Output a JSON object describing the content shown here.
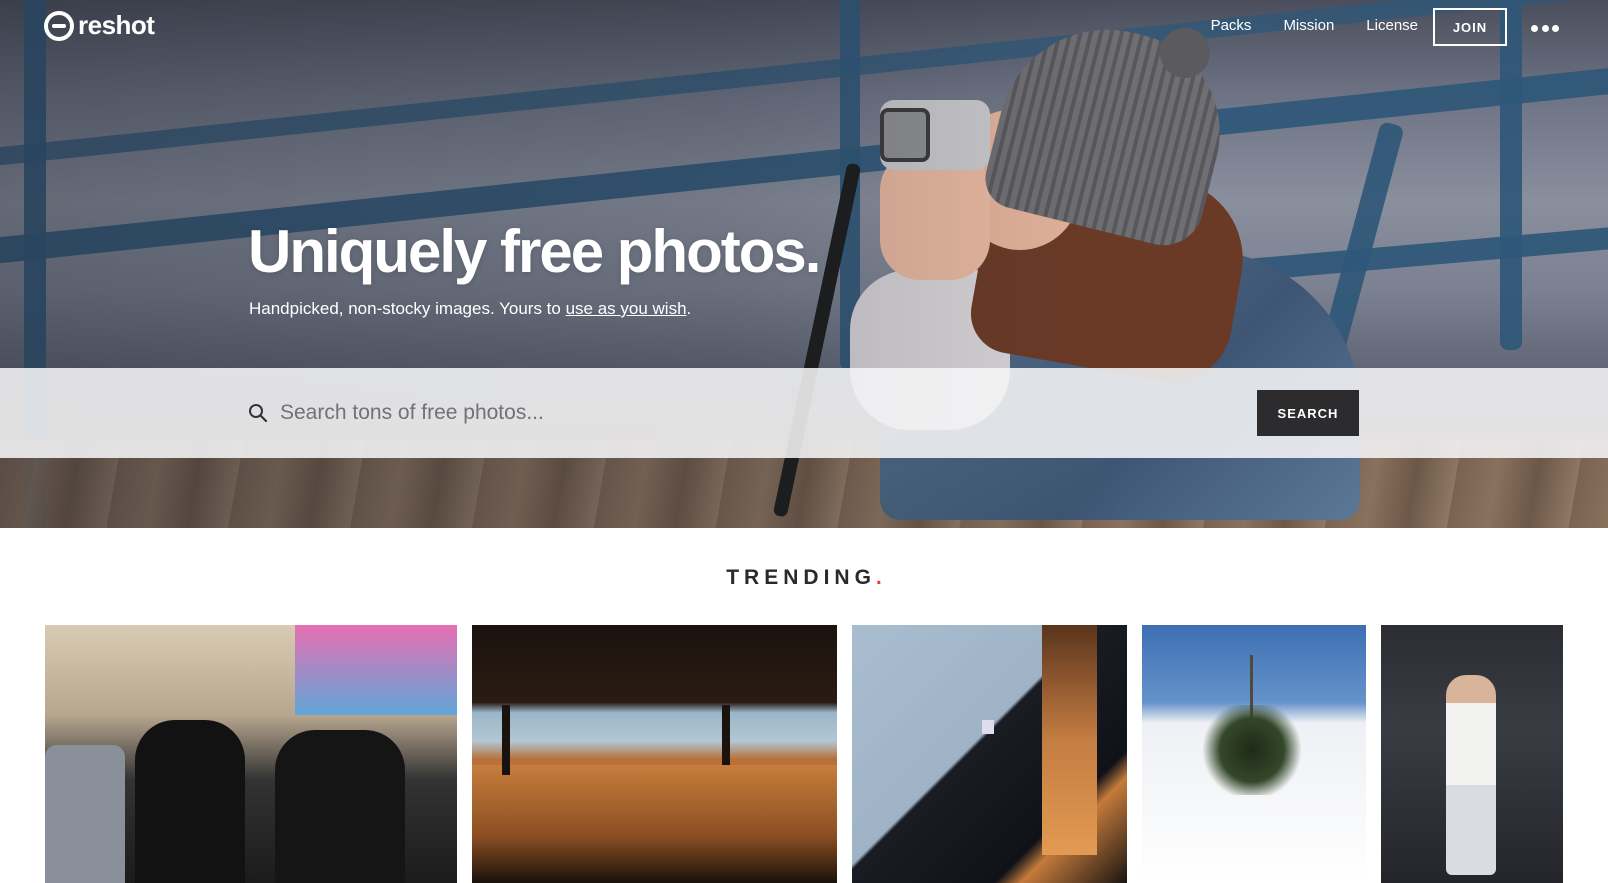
{
  "nav": {
    "logo_text": "reshot",
    "links": [
      "Packs",
      "Mission",
      "License"
    ],
    "join_label": "JOIN"
  },
  "hero": {
    "headline": "Uniquely free photos.",
    "subline_text": "Handpicked, non-stocky images. Yours to ",
    "subline_link": "use as you wish",
    "subline_end": "."
  },
  "search": {
    "placeholder": "Search tons of free photos...",
    "button_label": "SEARCH"
  },
  "trending": {
    "title": "TRENDING",
    "dot": ".",
    "accent_color": "#e0433a"
  },
  "icons": {
    "logo": "reshot-logo-icon",
    "more": "more-dots-icon",
    "search": "search-icon"
  }
}
